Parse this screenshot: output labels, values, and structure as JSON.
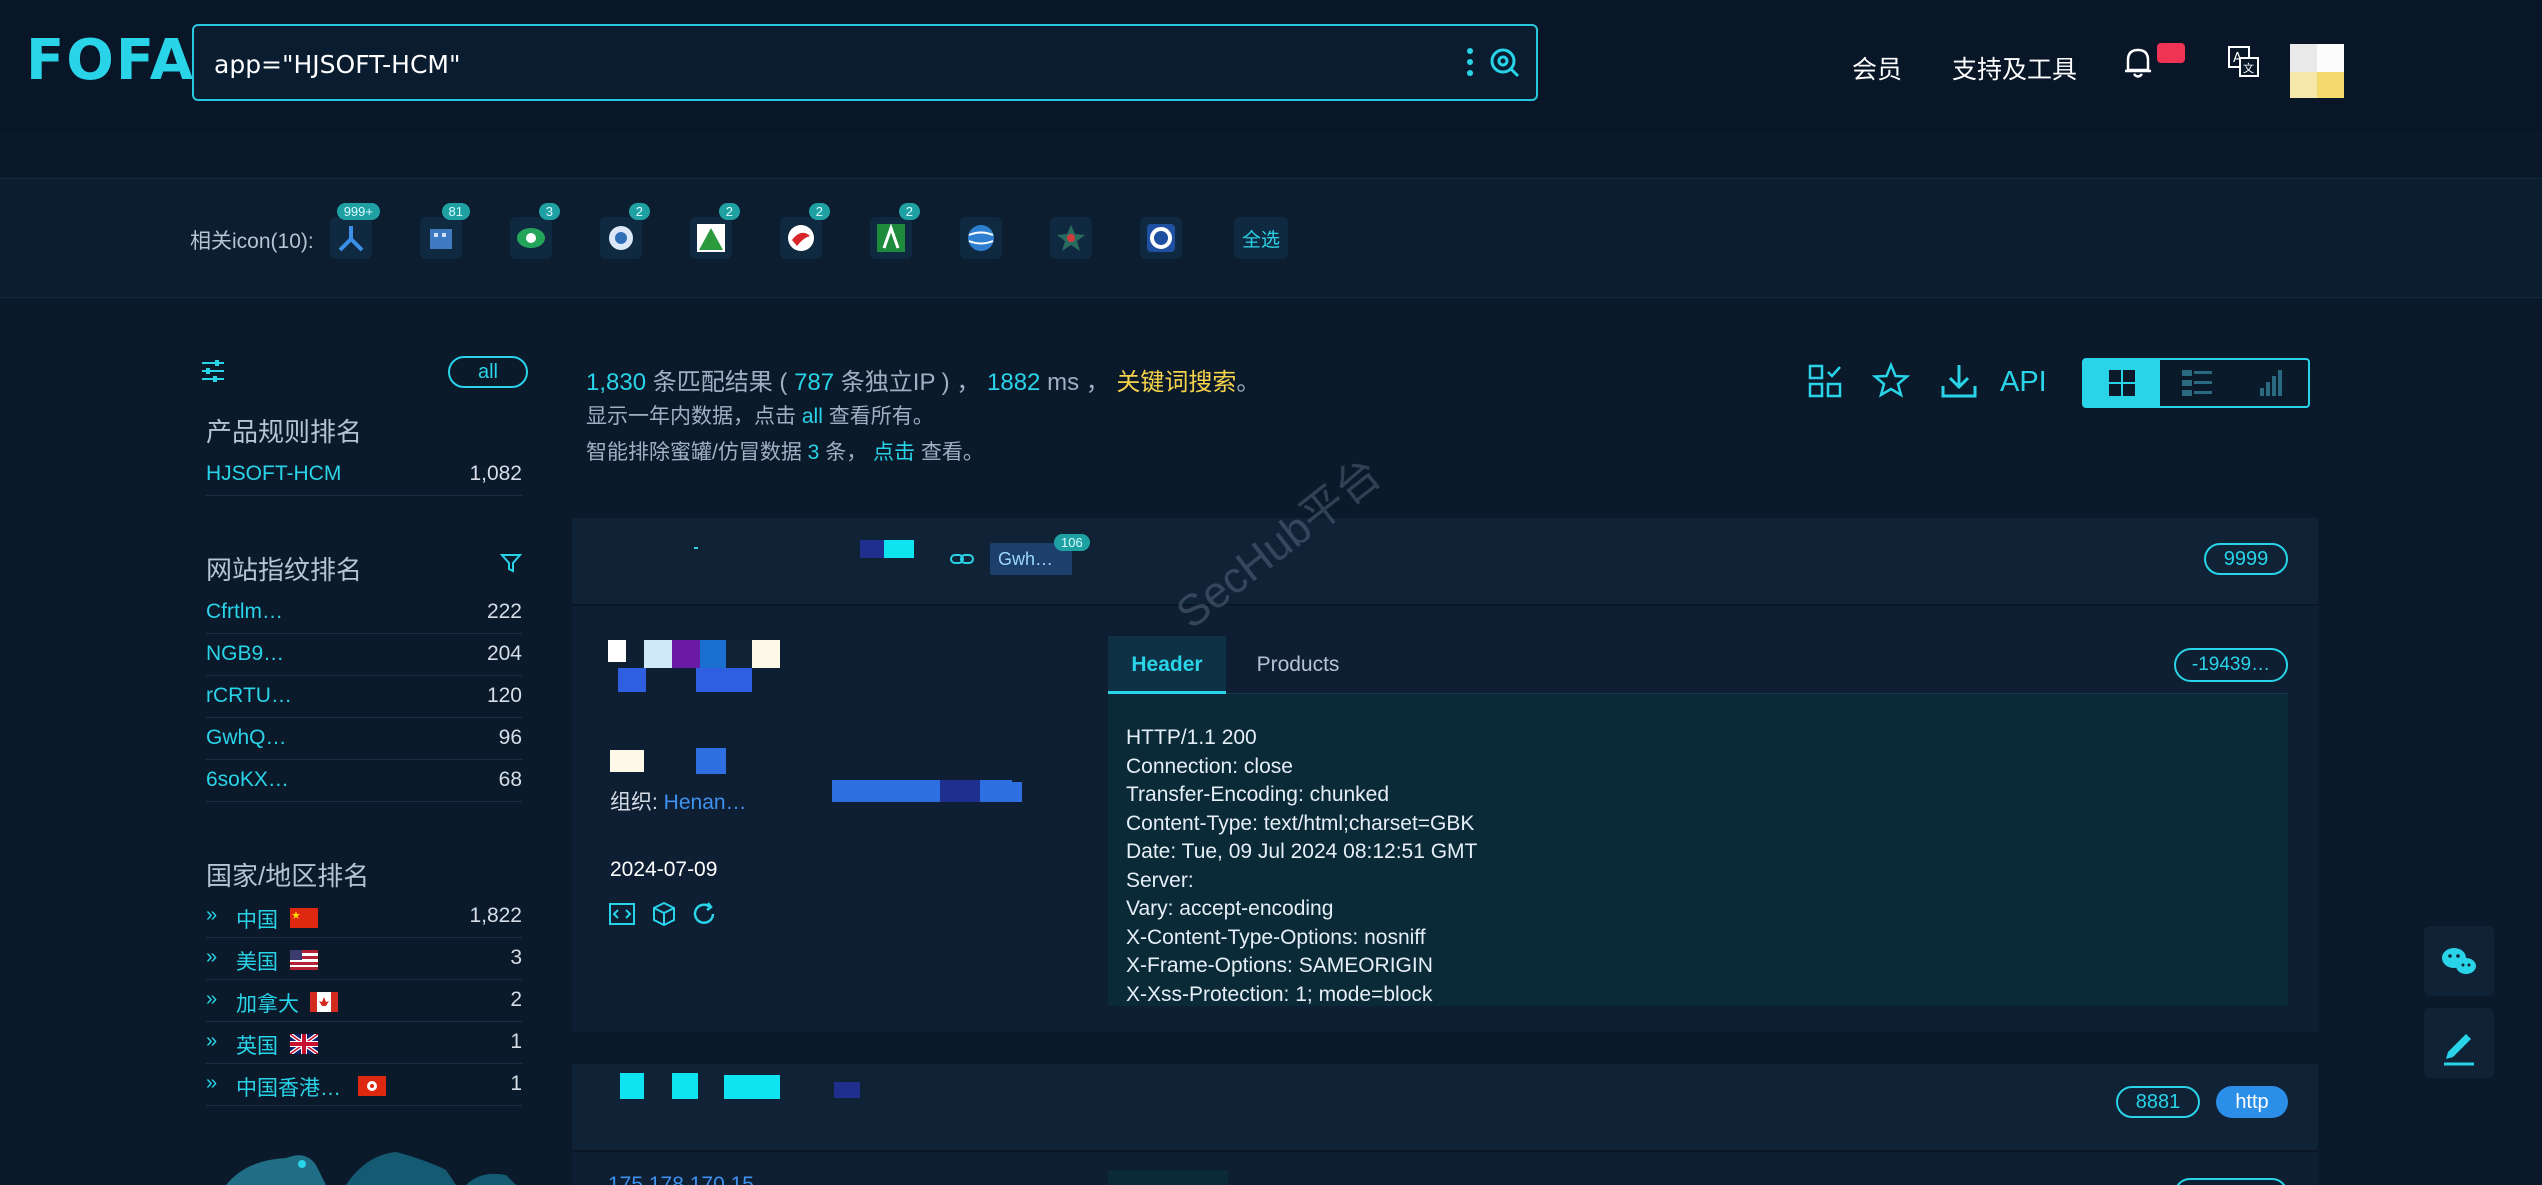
{
  "header": {
    "logo": "FOFA",
    "search_query": "app=\"HJSOFT-HCM\"",
    "nav_member": "会员",
    "nav_tools": "支持及工具"
  },
  "related_icons": {
    "label": "相关icon(10):",
    "items": [
      {
        "badge": "999+",
        "icon": "lanxin-logo-icon"
      },
      {
        "badge": "81",
        "icon": "building-logo-icon"
      },
      {
        "badge": "3",
        "icon": "green-eye-logo-icon"
      },
      {
        "badge": "2",
        "icon": "blue-circle-logo-icon"
      },
      {
        "badge": "2",
        "icon": "green-mountain-logo-icon"
      },
      {
        "badge": "2",
        "icon": "red-bird-logo-icon"
      },
      {
        "badge": "2",
        "icon": "green-a-logo-icon"
      },
      {
        "badge": "",
        "icon": "globe-logo-icon"
      },
      {
        "badge": "",
        "icon": "star-emblem-logo-icon"
      },
      {
        "badge": "",
        "icon": "blue-c-logo-icon"
      }
    ],
    "select_all": "全选"
  },
  "sidebar": {
    "all_label": "all",
    "product_title": "产品规则排名",
    "products": [
      {
        "name": "HJSOFT-HCM",
        "count": "1,082"
      }
    ],
    "fingerprint_title": "网站指纹排名",
    "fingerprints": [
      {
        "name": "Cfrtlm…",
        "count": "222"
      },
      {
        "name": "NGB9…",
        "count": "204"
      },
      {
        "name": "rCRTU…",
        "count": "120"
      },
      {
        "name": "GwhQ…",
        "count": "96"
      },
      {
        "name": "6soKX…",
        "count": "68"
      }
    ],
    "country_title": "国家/地区排名",
    "countries": [
      {
        "name": "中国",
        "count": "1,822",
        "flag": "cn"
      },
      {
        "name": "美国",
        "count": "3",
        "flag": "us"
      },
      {
        "name": "加拿大",
        "count": "2",
        "flag": "ca"
      },
      {
        "name": "英国",
        "count": "1",
        "flag": "gb"
      },
      {
        "name": "中国香港…",
        "count": "1",
        "flag": "hk"
      }
    ]
  },
  "results": {
    "total": "1,830",
    "total_suffix": " 条匹配结果 ( ",
    "unique_ip": "787",
    "unique_suffix": " 条独立IP ) ， ",
    "time": "1882",
    "time_suffix": " ms ， ",
    "keyword_search": "关键词搜索",
    "period": "。",
    "note1_prefix": "显示一年内数据，点击 ",
    "note1_link": "all",
    "note1_suffix": " 查看所有。",
    "note2_prefix": "智能排除蜜罐/仿冒数据 ",
    "note2_count": "3",
    "note2_mid": " 条， ",
    "note2_link": "点击",
    "note2_suffix": " 查看。",
    "api_label": "API"
  },
  "card1": {
    "tag": "Gwh…",
    "tag_badge": "106",
    "port": "9999",
    "org_label": "组织: ",
    "org_value": "Henan…",
    "date": "2024-07-09",
    "tab_header": "Header",
    "tab_products": "Products",
    "hash": "-19439…",
    "header_lines": [
      "HTTP/1.1 200",
      "Connection: close",
      "Transfer-Encoding: chunked",
      "Content-Type: text/html;charset=GBK",
      "Date: Tue, 09 Jul 2024 08:12:51 GMT",
      "Server:",
      "Vary: accept-encoding",
      "X-Content-Type-Options: nosniff",
      "X-Frame-Options: SAMEORIGIN",
      "X-Xss-Protection: 1; mode=block"
    ]
  },
  "card2": {
    "port": "8881",
    "protocol": "http",
    "ip_partial": "175.178.170.15"
  },
  "watermark": "SecHub平台",
  "colors": {
    "accent": "#29d3e8",
    "background": "#0b1a2b",
    "keyword": "#f6d34b",
    "link_blue": "#3f92f0"
  }
}
